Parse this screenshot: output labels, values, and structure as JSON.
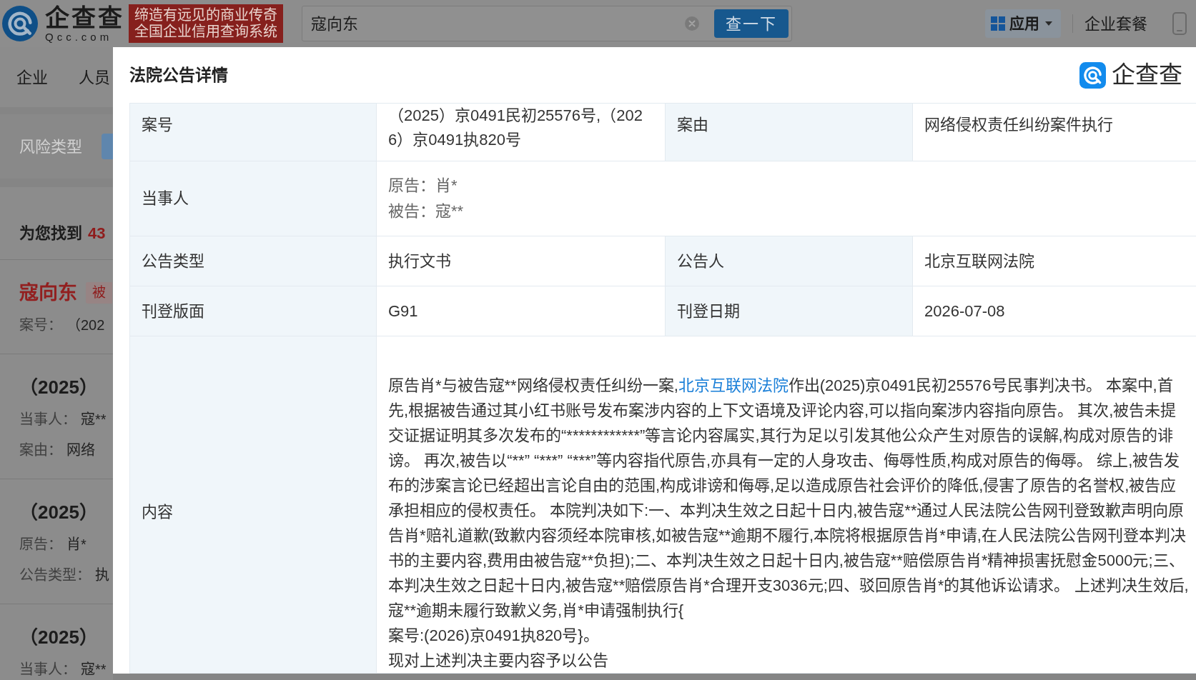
{
  "top_bar": {
    "logo_text": "企查查",
    "logo_domain": "Qcc.com",
    "slogan": [
      "缔造有远见的商业传奇",
      "全国企业信用查询系统"
    ],
    "search": {
      "value": "寇向东"
    },
    "search_button": "查一下",
    "apps_button": "应用",
    "links": [
      "企业套餐"
    ]
  },
  "nav_tabs": [
    "企业",
    "人员"
  ],
  "filter": {
    "label": "风险类型"
  },
  "results": {
    "summary": "为您找到",
    "count": "43",
    "items": [
      {
        "kind": "person",
        "title": "寇向东",
        "tag": "被",
        "fields": [
          {
            "label": "案号：",
            "value": "（202"
          }
        ]
      },
      {
        "kind": "case",
        "title": "（2025）",
        "fields": [
          {
            "label": "当事人：",
            "value": "寇**"
          },
          {
            "label": "案由：",
            "value": "网络"
          }
        ]
      },
      {
        "kind": "case",
        "title": "（2025）",
        "fields": [
          {
            "label": "原告：",
            "value": "肖*"
          },
          {
            "label": "公告类型：",
            "value": "执"
          }
        ]
      },
      {
        "kind": "case",
        "title": "（2025）",
        "fields": [
          {
            "label": "当事人：",
            "value": "寇**"
          }
        ]
      }
    ]
  },
  "dialog": {
    "title": "法院公告详情",
    "brand": "企查查",
    "rows": [
      {
        "kind": "pair",
        "fields": [
          {
            "label": "案号",
            "value": "（2025）京0491民初25576号,（2026）京0491执820号"
          },
          {
            "label": "案由",
            "value": "网络侵权责任纠纷案件执行"
          }
        ]
      },
      {
        "kind": "list",
        "label": "当事人",
        "lines": [
          "原告：肖*",
          "被告：寇**"
        ]
      },
      {
        "kind": "pair",
        "fields": [
          {
            "label": "公告类型",
            "value": "执行文书"
          },
          {
            "label": "公告人",
            "value": "北京互联网法院"
          }
        ]
      },
      {
        "kind": "pair",
        "fields": [
          {
            "label": "刊登版面",
            "value": "G91"
          },
          {
            "label": "刊登日期",
            "value": "2026-07-08"
          }
        ]
      },
      {
        "kind": "content",
        "label": "内容",
        "paragraphs": [
          {
            "parts": [
              {
                "kind": "text",
                "text": "原告肖*与被告寇**网络侵权责任纠纷一案,"
              },
              {
                "kind": "link",
                "text": "北京互联网法院"
              },
              {
                "kind": "text",
                "text": "作出(2025)京0491民初25576号民事判决书。 本案中,首先,根据被告通过其小红书账号发布案涉内容的上下文语境及评论内容,可以指向案涉内容指向原告。 其次,被告未提交证据证明其多次发布的“************”等言论内容属实,其行为足以引发其他公众产生对原告的误解,构成对原告的诽谤。 再次,被告以“**” “***” “***”等内容指代原告,亦具有一定的人身攻击、侮辱性质,构成对原告的侮辱。 综上,被告发布的涉案言论已经超出言论自由的范围,构成诽谤和侮辱,足以造成原告社会评价的降低,侵害了原告的名誉权,被告应承担相应的侵权责任。 本院判决如下:一、本判决生效之日起十日内,被告寇**通过人民法院公告网刊登致歉声明向原告肖*赔礼道歉(致歉内容须经本院审核,如被告寇**逾期不履行,本院将根据原告肖*申请,在人民法院公告网刊登本判决书的主要内容,费用由被告寇**负担);二、本判决生效之日起十日内,被告寇**赔偿原告肖*精神损害抚慰金5000元;三、本判决生效之日起十日内,被告寇**赔偿原告肖*合理开支3036元;四、驳回原告肖*的其他诉讼请求。 上述判决生效后,寇**逾期未履行致歉义务,肖*申请强制执行{"
              }
            ]
          },
          {
            "parts": [
              {
                "kind": "text",
                "text": "案号:(2026)京0491执820号}。"
              }
            ]
          },
          {
            "parts": [
              {
                "kind": "text",
                "text": "现对上述判决主要内容予以公告"
              }
            ]
          }
        ]
      }
    ]
  }
}
